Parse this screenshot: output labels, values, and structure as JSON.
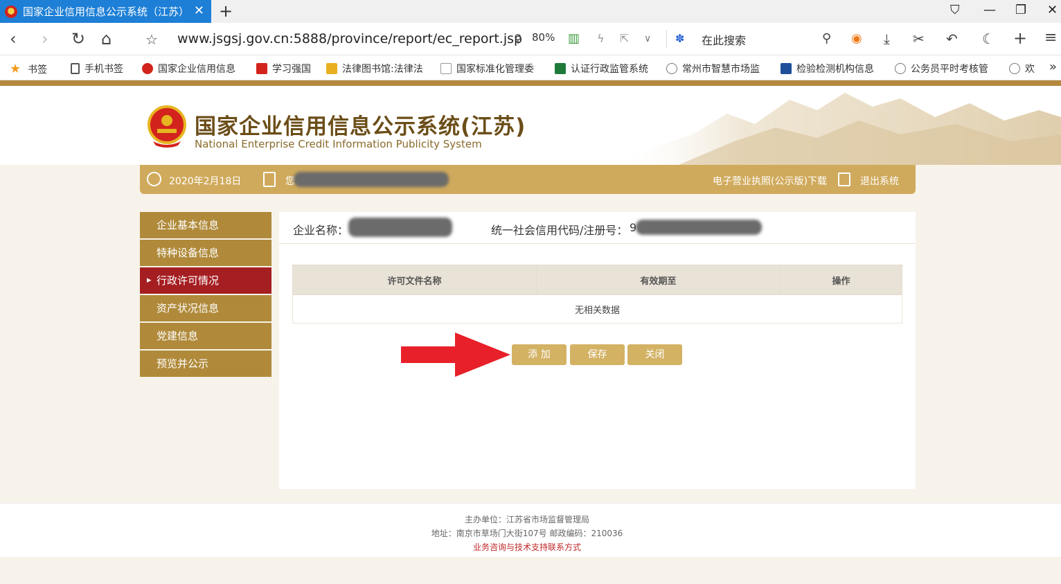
{
  "browser": {
    "tab_title": "国家企业信用信息公示系统（江苏）",
    "url": "www.jsgsj.gov.cn:5888/province/report/ec_report.jsp",
    "zoom": "80%",
    "search_placeholder": "在此搜索",
    "bookmarks": [
      "书签",
      "手机书签",
      "国家企业信用信息",
      "学习强国",
      "法律图书馆:法律法",
      "国家标准化管理委",
      "认证行政监管系统",
      "常州市智慧市场监",
      "检验检测机构信息",
      "公务员平时考核管",
      "欢"
    ]
  },
  "header": {
    "title": "国家企业信用信息公示系统(江苏)",
    "subtitle": "National Enterprise Credit Information Publicity System"
  },
  "infobar": {
    "date": "2020年2月18日",
    "user_prefix": "您",
    "download": "电子营业执照(公示版)下载",
    "exit": "退出系统"
  },
  "sidebar": {
    "items": [
      "企业基本信息",
      "特种设备信息",
      "行政许可情况",
      "资产状况信息",
      "党建信息",
      "预览并公示"
    ],
    "active_index": 2
  },
  "main": {
    "company_label": "企业名称：",
    "code_label": "统一社会信用代码/注册号：",
    "code_prefix": "9",
    "table": {
      "headers": [
        "许可文件名称",
        "有效期至",
        "操作"
      ],
      "empty_text": "无相关数据"
    },
    "buttons": {
      "add": "添 加",
      "save": "保存",
      "close": "关闭"
    }
  },
  "footer": {
    "line1": "主办单位：江苏省市场监督管理局",
    "line2": "地址：南京市草场门大街107号    邮政编码：210036",
    "line3": "业务咨询与技术支持联系方式"
  },
  "colors": {
    "gold": "#d0aa5c",
    "sidebar": "#b08a3a",
    "active": "#a51e22",
    "arrow": "#e8202a"
  }
}
